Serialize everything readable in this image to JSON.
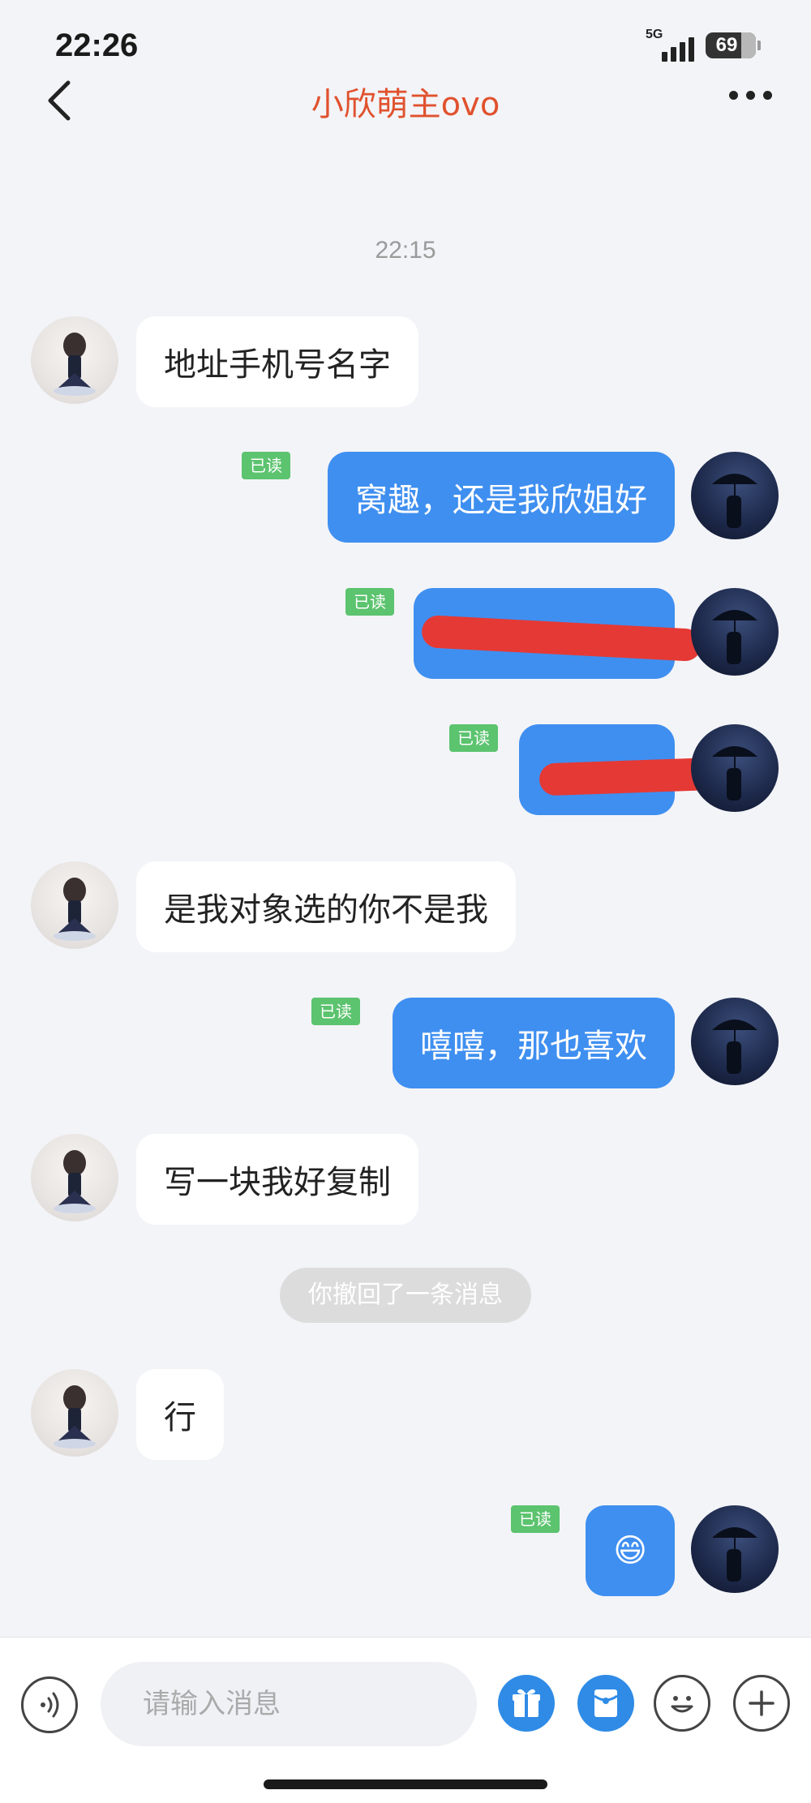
{
  "status_bar": {
    "time": "22:26",
    "network": "5G",
    "battery": "69"
  },
  "header": {
    "title": "小欣萌主ovo",
    "back_icon": "chevron-left-icon",
    "more_icon": "more-dots-icon"
  },
  "timestamp": "22:15",
  "read_label": "已读",
  "messages": [
    {
      "side": "in",
      "text": "地址手机号名字"
    },
    {
      "side": "out",
      "text": "窝趣，还是我欣姐好",
      "read": true
    },
    {
      "side": "out",
      "text": "",
      "read": true,
      "redacted": true
    },
    {
      "side": "out",
      "text": "",
      "read": true,
      "redacted": true
    },
    {
      "side": "in",
      "text": "是我对象选的你不是我"
    },
    {
      "side": "out",
      "text": "嘻嘻，那也喜欢",
      "read": true
    },
    {
      "side": "in",
      "text": "写一块我好复制"
    },
    {
      "side": "in",
      "text": "行"
    },
    {
      "side": "out",
      "text": "😄",
      "read": true
    }
  ],
  "system_notice": "你撤回了一条消息",
  "input": {
    "placeholder": "请输入消息"
  },
  "toolbar_icons": [
    "voice-icon",
    "gift-icon",
    "red-packet-icon",
    "emoji-icon",
    "plus-icon"
  ],
  "colors": {
    "title": "#e0522e",
    "bubble_out": "#3f8ff0",
    "read_badge": "#5cc36f",
    "redaction": "#e53935"
  }
}
